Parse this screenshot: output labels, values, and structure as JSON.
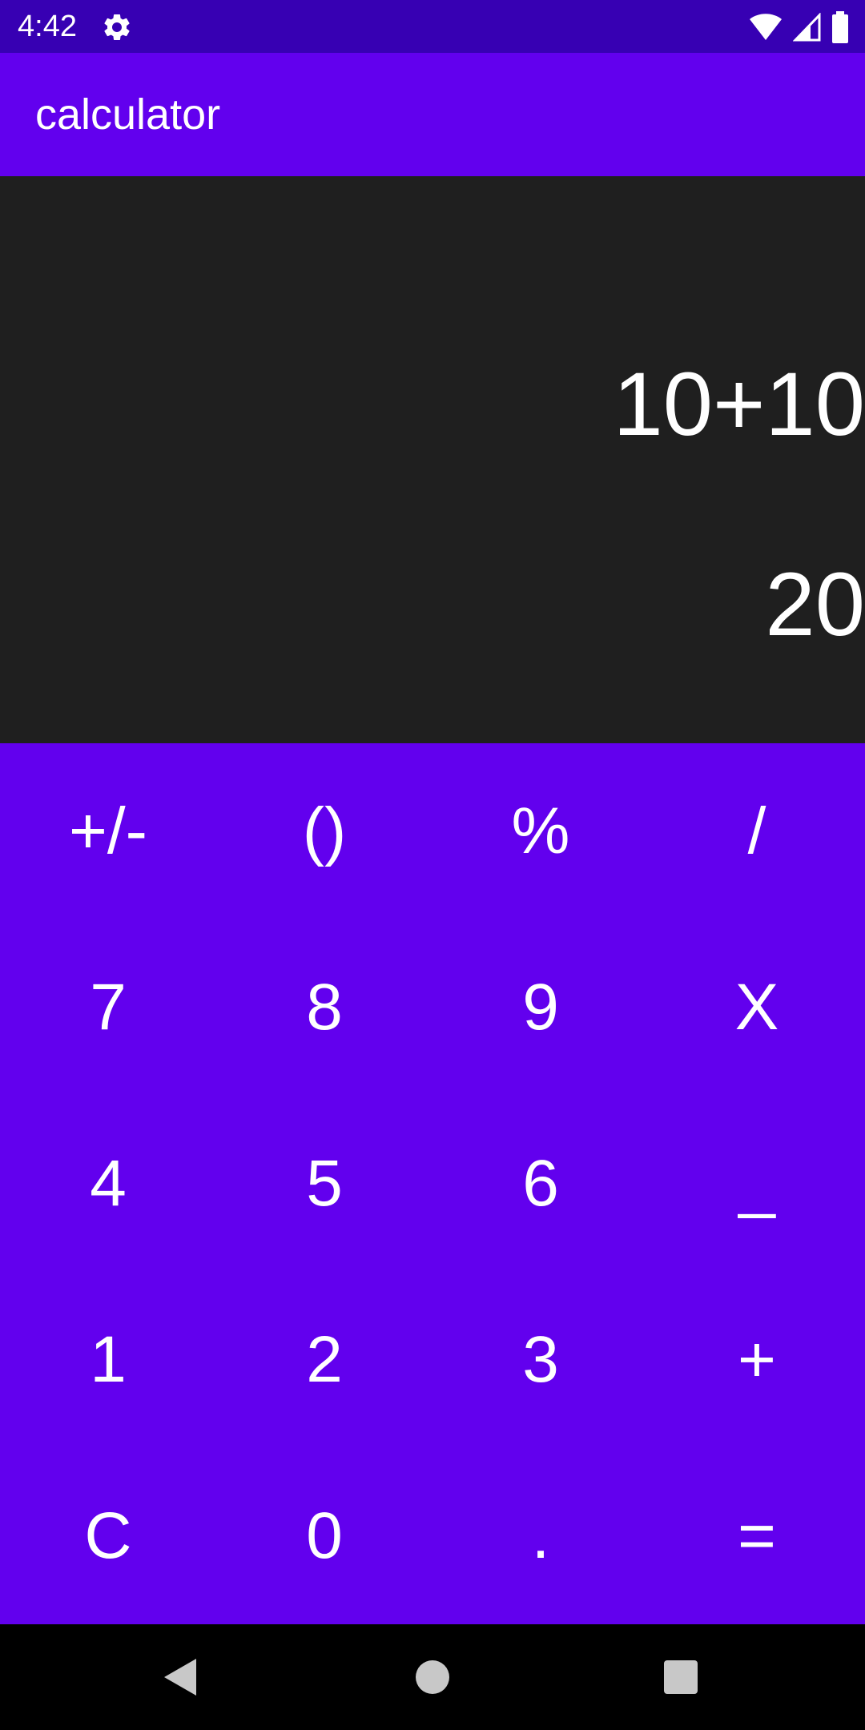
{
  "status_bar": {
    "time": "4:42",
    "icons": [
      "settings-icon",
      "wifi-icon",
      "signal-icon",
      "battery-icon"
    ],
    "background": "#3700B3"
  },
  "app_bar": {
    "title": "calculator",
    "background": "#6200EE"
  },
  "display": {
    "expression": "10+10",
    "result": "20",
    "background": "#1F1F1F"
  },
  "keypad": {
    "background": "#6200EE",
    "rows": [
      [
        {
          "label": "+/-",
          "name": "plus-minus-button"
        },
        {
          "label": "()",
          "name": "parentheses-button"
        },
        {
          "label": "%",
          "name": "percent-button"
        },
        {
          "label": "/",
          "name": "divide-button"
        }
      ],
      [
        {
          "label": "7",
          "name": "seven-button"
        },
        {
          "label": "8",
          "name": "eight-button"
        },
        {
          "label": "9",
          "name": "nine-button"
        },
        {
          "label": "X",
          "name": "multiply-button"
        }
      ],
      [
        {
          "label": "4",
          "name": "four-button"
        },
        {
          "label": "5",
          "name": "five-button"
        },
        {
          "label": "6",
          "name": "six-button"
        },
        {
          "label": "_",
          "name": "minus-button"
        }
      ],
      [
        {
          "label": "1",
          "name": "one-button"
        },
        {
          "label": "2",
          "name": "two-button"
        },
        {
          "label": "3",
          "name": "three-button"
        },
        {
          "label": "+",
          "name": "plus-button"
        }
      ],
      [
        {
          "label": "C",
          "name": "clear-button"
        },
        {
          "label": "0",
          "name": "zero-button"
        },
        {
          "label": ".",
          "name": "decimal-button"
        },
        {
          "label": "=",
          "name": "equals-button"
        }
      ]
    ]
  },
  "nav_bar": {
    "buttons": [
      "back-icon",
      "home-icon",
      "recents-icon"
    ]
  }
}
